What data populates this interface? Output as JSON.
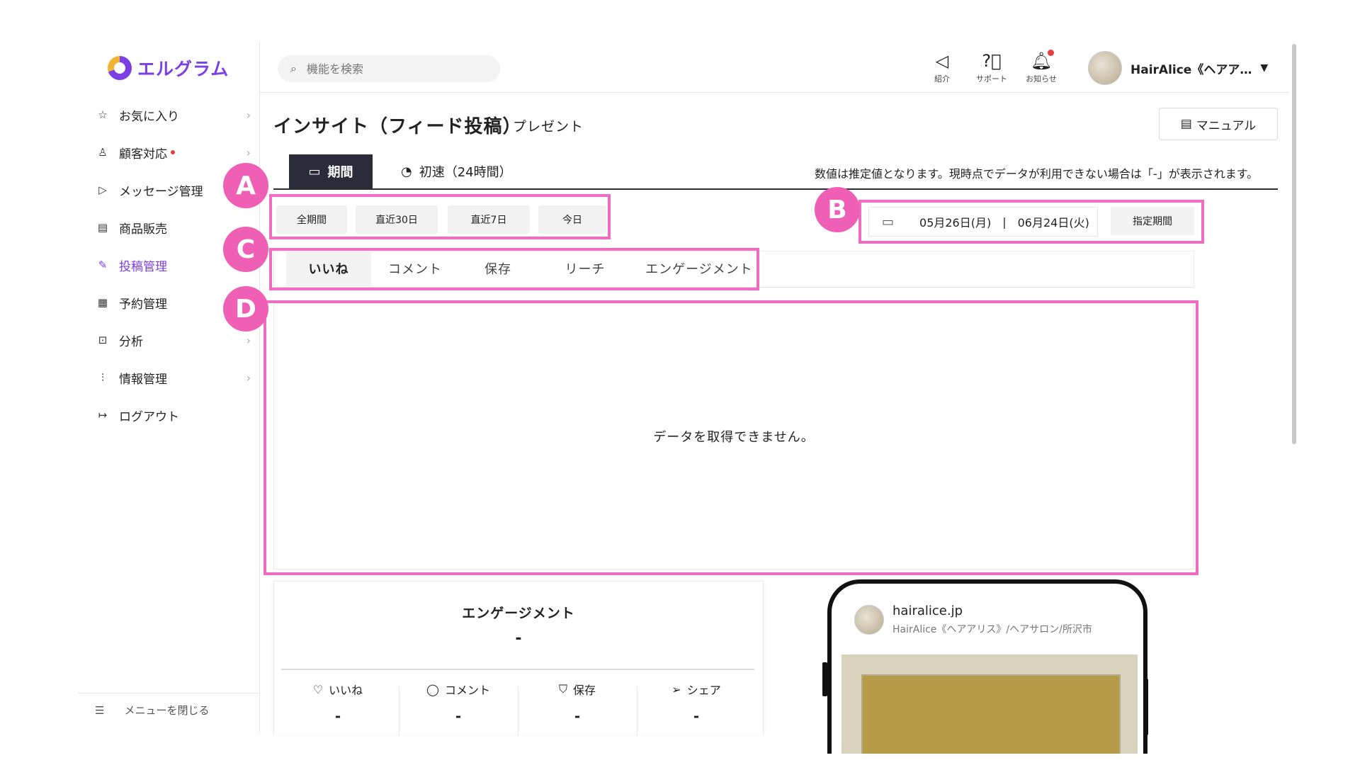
{
  "sidebar": {
    "logo_text": "エルグラム",
    "items": [
      {
        "label": "お気に入り",
        "icon": "star-icon"
      },
      {
        "label": "顧客対応",
        "icon": "user-icon"
      },
      {
        "label": "メッセージ管理",
        "icon": "send-icon"
      },
      {
        "label": "商品販売",
        "icon": "shop-icon"
      },
      {
        "label": "投稿管理",
        "icon": "edit-icon"
      },
      {
        "label": "予約管理",
        "icon": "calendar-icon"
      },
      {
        "label": "分析",
        "icon": "analysis-icon"
      },
      {
        "label": "情報管理",
        "icon": "chart-icon"
      },
      {
        "label": "ログアウト",
        "icon": "logout-icon"
      }
    ],
    "close_menu": "メニューを閉じる"
  },
  "header": {
    "search_placeholder": "機能を検索",
    "intro_label": "紹介",
    "support_label": "サポート",
    "notice_label": "お知らせ",
    "user_name": "HairAlice《ヘアア…"
  },
  "page": {
    "title": "インサイト（フィード投稿）",
    "present": "プレゼント",
    "manual": "マニュアル",
    "tab_period": "期間",
    "tab_first": "初速（24時間）",
    "notice": "数値は推定値となります。現時点でデータが利用できない場合は「-」が表示されます。"
  },
  "period_buttons": [
    "全期間",
    "直近30日",
    "直近7日",
    "今日"
  ],
  "date_range": {
    "start": "05月26日(月)",
    "separator": "|",
    "end": "06月24日(火)",
    "custom": "指定期間"
  },
  "metric_tabs": [
    "いいね",
    "コメント",
    "保存",
    "リーチ",
    "エンゲージメント"
  ],
  "chart": {
    "empty_message": "データを取得できません。"
  },
  "engagement": {
    "title": "エンゲージメント",
    "value": "-",
    "stats": [
      {
        "label": "いいね",
        "value": "-",
        "icon": "heart-icon"
      },
      {
        "label": "コメント",
        "value": "-",
        "icon": "comment-icon"
      },
      {
        "label": "保存",
        "value": "-",
        "icon": "bookmark-icon"
      },
      {
        "label": "シェア",
        "value": "-",
        "icon": "share-icon"
      }
    ]
  },
  "post_preview": {
    "username": "hairalice.jp",
    "subtitle": "HairAlice《ヘアアリス》/ヘアサロン/所沢市"
  },
  "annotations": {
    "a": "A",
    "b": "B",
    "c": "C",
    "d": "D"
  },
  "colors": {
    "brand": "#7b3fe4",
    "highlight": "#f06cc0",
    "badge": "#ef5fb5",
    "dark_tab": "#2b2b3a"
  }
}
